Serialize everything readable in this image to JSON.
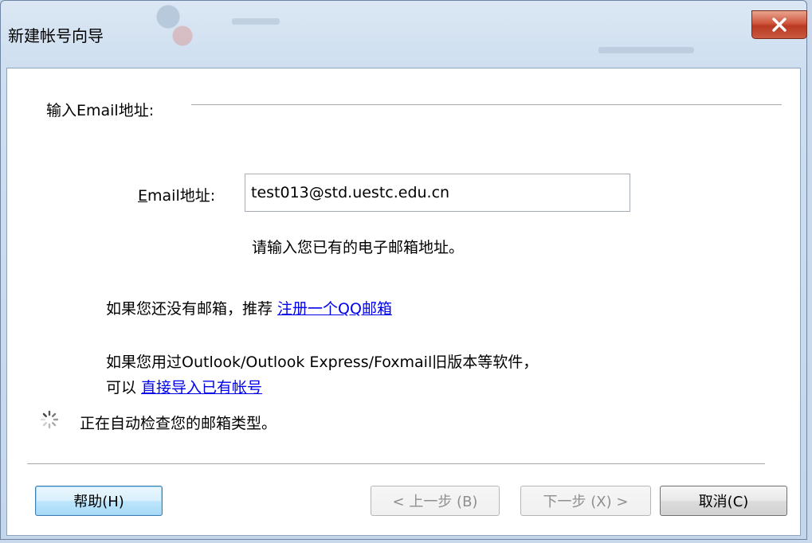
{
  "window": {
    "title": "新建帐号向导"
  },
  "section": {
    "heading": "输入Email地址:"
  },
  "email": {
    "label_first": "E",
    "label_rest": "mail地址:",
    "value": "test013@std.uestc.edu.cn",
    "hint": "请输入您已有的电子邮箱地址。"
  },
  "register": {
    "text": "如果您还没有邮箱，推荐 ",
    "link": "注册一个QQ邮箱"
  },
  "import": {
    "line1": "如果您用过Outlook/Outlook Express/Foxmail旧版本等软件，",
    "line2_prefix": "可以 ",
    "link": "直接导入已有帐号"
  },
  "status": {
    "text": "正在自动检查您的邮箱类型。"
  },
  "buttons": {
    "help": "帮助(H)",
    "prev": "< 上一步 (B)",
    "next": "下一步 (X) >",
    "cancel": "取消(C)"
  },
  "colors": {
    "link": "#0000ee",
    "close_button": "#c9482f"
  },
  "icons": {
    "close": "close-icon",
    "spinner": "loading-spinner-icon"
  }
}
